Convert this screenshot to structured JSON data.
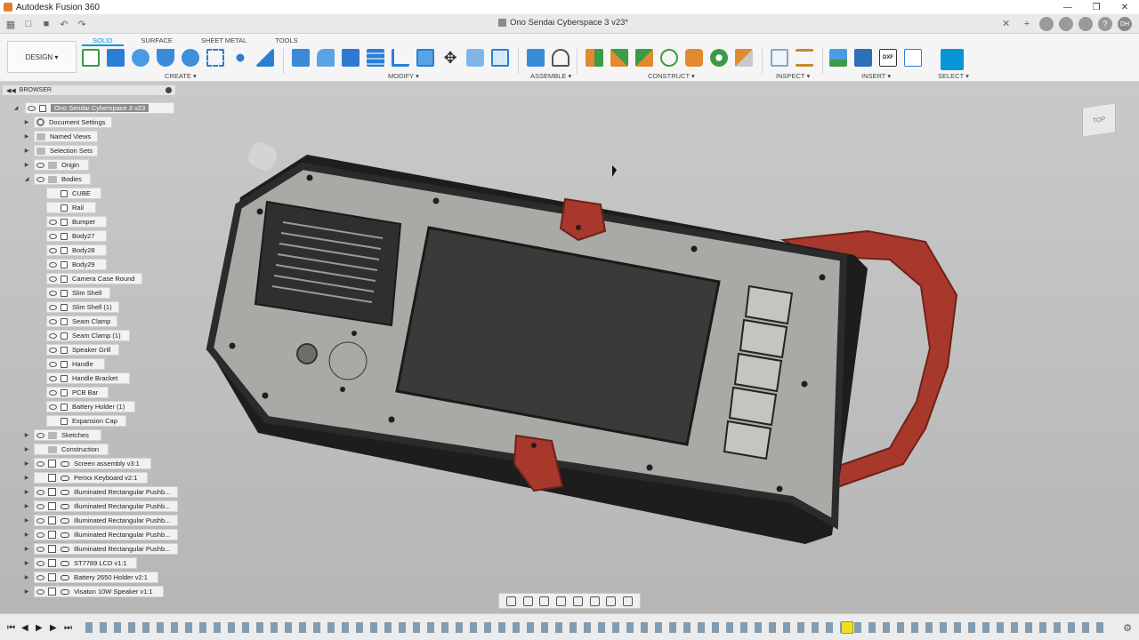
{
  "window": {
    "title": "Autodesk Fusion 360"
  },
  "document_tab": {
    "title": "Ono Sendai Cyberspace 3 v23*"
  },
  "account": {
    "initials": "DH"
  },
  "workspace": {
    "label": "DESIGN"
  },
  "toolbar": {
    "tabs": [
      "SOLID",
      "SURFACE",
      "SHEET METAL",
      "TOOLS"
    ],
    "groups": [
      "CREATE",
      "MODIFY",
      "ASSEMBLE",
      "CONSTRUCT",
      "INSPECT",
      "INSERT",
      "SELECT"
    ],
    "accent": "#0696d7"
  },
  "browser": {
    "title": "BROWSER",
    "root": "Ono Sendai Cyberspace 3 v23",
    "top_folders": [
      "Document Settings",
      "Named Views",
      "Selection Sets",
      "Origin",
      "Bodies"
    ],
    "bodies": [
      "CUBE",
      "Rail",
      "Bumper",
      "Body27",
      "Body28",
      "Body29",
      "Camera Case Round",
      "Slim Shell",
      "Slim Shell (1)",
      "Seam Clamp",
      "Seam Clamp (1)",
      "Speaker Grill",
      "Handle",
      "Handle Bracket",
      "PCB Bar",
      "Battery Holder (1)",
      "Expansion Cap"
    ],
    "after_bodies": [
      "Sketches",
      "Construction"
    ],
    "components": [
      "Screen assembly v3:1",
      "Perixx Keyboard v2:1",
      "Illuminated Rectangular Pushb...",
      "Illuminated Rectangular Pushb...",
      "Illuminated Rectangular Pushb...",
      "Illuminated Rectangular Pushb...",
      "Illuminated Rectangular Pushb...",
      "ST7789 LCD v1:1",
      "Battery 2650 Holder v2:1",
      "Visaton 10W Speaker v1:1"
    ]
  },
  "viewcube": {
    "face": "TOP"
  },
  "model_colors": {
    "frame": "#2b2b2b",
    "panel": "#a9a9a6",
    "screen": "#3a3a38",
    "accent_red": "#a8382c",
    "keys": "#c4c4c0"
  }
}
